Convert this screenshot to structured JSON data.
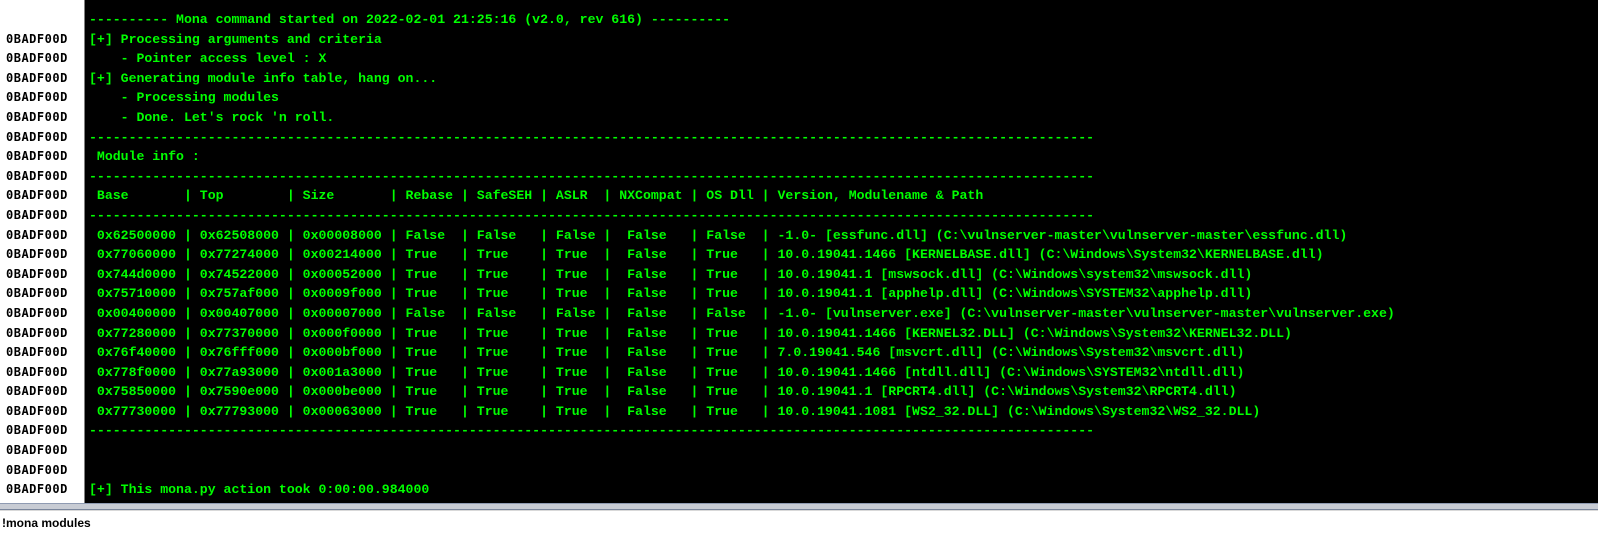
{
  "log": {
    "rows": [
      {
        "addr": "",
        "text": "---------- Mona command started on 2022-02-01 21:25:16 (v2.0, rev 616) ----------"
      },
      {
        "addr": "0BADF00D",
        "text": "[+] Processing arguments and criteria"
      },
      {
        "addr": "0BADF00D",
        "text": "    - Pointer access level : X"
      },
      {
        "addr": "0BADF00D",
        "text": "[+] Generating module info table, hang on..."
      },
      {
        "addr": "0BADF00D",
        "text": "    - Processing modules"
      },
      {
        "addr": "0BADF00D",
        "text": "    - Done. Let's rock 'n roll."
      },
      {
        "addr": "0BADF00D",
        "text": "-------------------------------------------------------------------------------------------------------------------------------"
      },
      {
        "addr": "0BADF00D",
        "text": " Module info :"
      },
      {
        "addr": "0BADF00D",
        "text": "-------------------------------------------------------------------------------------------------------------------------------"
      },
      {
        "addr": "0BADF00D",
        "text": " Base       | Top        | Size       | Rebase | SafeSEH | ASLR  | NXCompat | OS Dll | Version, Modulename & Path"
      },
      {
        "addr": "0BADF00D",
        "text": "-------------------------------------------------------------------------------------------------------------------------------"
      },
      {
        "addr": "0BADF00D",
        "text": " 0x62500000 | 0x62508000 | 0x00008000 | False  | False   | False |  False   | False  | -1.0- [essfunc.dll] (C:\\vulnserver-master\\vulnserver-master\\essfunc.dll)"
      },
      {
        "addr": "0BADF00D",
        "text": " 0x77060000 | 0x77274000 | 0x00214000 | True   | True    | True  |  False   | True   | 10.0.19041.1466 [KERNELBASE.dll] (C:\\Windows\\System32\\KERNELBASE.dll)"
      },
      {
        "addr": "0BADF00D",
        "text": " 0x744d0000 | 0x74522000 | 0x00052000 | True   | True    | True  |  False   | True   | 10.0.19041.1 [mswsock.dll] (C:\\Windows\\system32\\mswsock.dll)"
      },
      {
        "addr": "0BADF00D",
        "text": " 0x75710000 | 0x757af000 | 0x0009f000 | True   | True    | True  |  False   | True   | 10.0.19041.1 [apphelp.dll] (C:\\Windows\\SYSTEM32\\apphelp.dll)"
      },
      {
        "addr": "0BADF00D",
        "text": " 0x00400000 | 0x00407000 | 0x00007000 | False  | False   | False |  False   | False  | -1.0- [vulnserver.exe] (C:\\vulnserver-master\\vulnserver-master\\vulnserver.exe)"
      },
      {
        "addr": "0BADF00D",
        "text": " 0x77280000 | 0x77370000 | 0x000f0000 | True   | True    | True  |  False   | True   | 10.0.19041.1466 [KERNEL32.DLL] (C:\\Windows\\System32\\KERNEL32.DLL)"
      },
      {
        "addr": "0BADF00D",
        "text": " 0x76f40000 | 0x76fff000 | 0x000bf000 | True   | True    | True  |  False   | True   | 7.0.19041.546 [msvcrt.dll] (C:\\Windows\\System32\\msvcrt.dll)"
      },
      {
        "addr": "0BADF00D",
        "text": " 0x778f0000 | 0x77a93000 | 0x001a3000 | True   | True    | True  |  False   | True   | 10.0.19041.1466 [ntdll.dll] (C:\\Windows\\SYSTEM32\\ntdll.dll)"
      },
      {
        "addr": "0BADF00D",
        "text": " 0x75850000 | 0x7590e000 | 0x000be000 | True   | True    | True  |  False   | True   | 10.0.19041.1 [RPCRT4.dll] (C:\\Windows\\System32\\RPCRT4.dll)"
      },
      {
        "addr": "0BADF00D",
        "text": " 0x77730000 | 0x77793000 | 0x00063000 | True   | True    | True  |  False   | True   | 10.0.19041.1081 [WS2_32.DLL] (C:\\Windows\\System32\\WS2_32.DLL)"
      },
      {
        "addr": "0BADF00D",
        "text": "-------------------------------------------------------------------------------------------------------------------------------"
      },
      {
        "addr": "0BADF00D",
        "text": ""
      },
      {
        "addr": "0BADF00D",
        "text": ""
      },
      {
        "addr": "0BADF00D",
        "text": "[+] This mona.py action took 0:00:00.984000"
      }
    ]
  },
  "command": {
    "value": "!mona modules"
  },
  "colors": {
    "log_background": "#000000",
    "log_text": "#00ff00",
    "address_column": "#ffffff",
    "address_text": "#000000"
  }
}
